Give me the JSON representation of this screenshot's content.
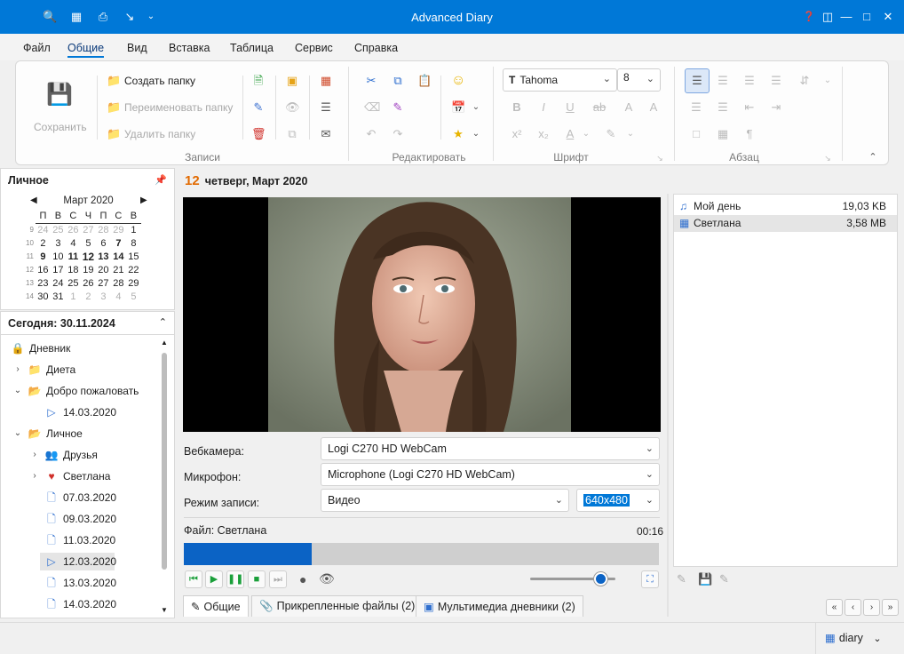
{
  "window": {
    "title": "Advanced Diary",
    "quick_access_icons": [
      "search-icon",
      "export-icon",
      "print-icon",
      "import-icon",
      "customize-chevron-icon"
    ],
    "controls": [
      "help-icon",
      "restore-layout-icon",
      "minimize-icon",
      "maximize-icon",
      "close-icon"
    ]
  },
  "menu": {
    "items": [
      "Файл",
      "Общие",
      "Вид",
      "Вставка",
      "Таблица",
      "Сервис",
      "Справка"
    ],
    "active": "Общие"
  },
  "ribbon": {
    "save_label": "Сохранить",
    "create_folder": "Создать папку",
    "rename_folder": "Переименовать папку",
    "delete_folder": "Удалить папку",
    "group_records": "Записи",
    "group_edit": "Редактировать",
    "group_font": "Шрифт",
    "group_paragraph": "Абзац",
    "font_name": "Tahoma",
    "font_size": "8",
    "font_icon": "T"
  },
  "left": {
    "personal_title": "Личное",
    "calendar": {
      "month": "Март 2020",
      "weekdays": [
        "П",
        "В",
        "С",
        "Ч",
        "П",
        "С",
        "В"
      ],
      "weeks": [
        {
          "wk": "9",
          "days": [
            "24",
            "25",
            "26",
            "27",
            "28",
            "29",
            "1"
          ]
        },
        {
          "wk": "10",
          "days": [
            "2",
            "3",
            "4",
            "5",
            "6",
            "7",
            "8"
          ]
        },
        {
          "wk": "11",
          "days": [
            "9",
            "10",
            "11",
            "12",
            "13",
            "14",
            "15"
          ]
        },
        {
          "wk": "12",
          "days": [
            "16",
            "17",
            "18",
            "19",
            "20",
            "21",
            "22"
          ]
        },
        {
          "wk": "13",
          "days": [
            "23",
            "24",
            "25",
            "26",
            "27",
            "28",
            "29"
          ]
        },
        {
          "wk": "14",
          "days": [
            "30",
            "31",
            "1",
            "2",
            "3",
            "4",
            "5"
          ]
        }
      ]
    },
    "today_label": "Сегодня: 30.11.2024",
    "tree": [
      {
        "label": "Дневник",
        "level": 0,
        "icon": "diary-icon",
        "twisty": ""
      },
      {
        "label": "Диета",
        "level": 1,
        "icon": "folder-icon",
        "twisty": "›"
      },
      {
        "label": "Добро пожаловать",
        "level": 1,
        "icon": "folder-open-icon",
        "twisty": "⌄"
      },
      {
        "label": "14.03.2020",
        "level": 2,
        "icon": "video-note-icon",
        "twisty": ""
      },
      {
        "label": "Личное",
        "level": 1,
        "icon": "folder-open-icon",
        "twisty": "⌄"
      },
      {
        "label": "Друзья",
        "level": 2,
        "icon": "folder-people-icon",
        "twisty": "›"
      },
      {
        "label": "Светлана",
        "level": 2,
        "icon": "folder-heart-icon",
        "twisty": "›"
      },
      {
        "label": "07.03.2020",
        "level": 2,
        "icon": "note-icon",
        "twisty": ""
      },
      {
        "label": "09.03.2020",
        "level": 2,
        "icon": "note-icon",
        "twisty": ""
      },
      {
        "label": "11.03.2020",
        "level": 2,
        "icon": "note-icon",
        "twisty": ""
      },
      {
        "label": "12.03.2020",
        "level": 2,
        "icon": "video-note-icon",
        "twisty": "",
        "selected": true
      },
      {
        "label": "13.03.2020",
        "level": 2,
        "icon": "note-icon",
        "twisty": ""
      },
      {
        "label": "14.03.2020",
        "level": 2,
        "icon": "note-icon",
        "twisty": ""
      }
    ]
  },
  "center": {
    "day_number": "12",
    "date_text": "четверг, Март 2020",
    "webcam_label": "Вебкамера:",
    "webcam_value": "Logi C270 HD WebCam",
    "mic_label": "Микрофон:",
    "mic_value": "Microphone (Logi C270 HD WebCam)",
    "mode_label": "Режим записи:",
    "mode_value": "Видео",
    "resolution_value": "640x480",
    "file_label": "Файл: Светлана",
    "duration": "00:16",
    "progress_fraction": 0.27,
    "volume_fraction": 0.82,
    "tabs": [
      {
        "label": "Общие",
        "icon": "pencil-icon"
      },
      {
        "label": "Прикрепленные файлы (2)",
        "icon": "paperclip-icon"
      },
      {
        "label": "Мультимедиа дневники (2)",
        "icon": "multimedia-icon"
      }
    ]
  },
  "right": {
    "files": [
      {
        "name": "Мой день",
        "size": "19,03 KB",
        "icon": "audio-file-icon"
      },
      {
        "name": "Светлана",
        "size": "3,58 MB",
        "icon": "video-file-icon",
        "selected": true
      }
    ]
  },
  "status": {
    "diary_label": "diary"
  },
  "colors": {
    "titlebar": "#0078d7",
    "accent": "#0078d7",
    "date_accent": "#e26a00",
    "progress_fill": "#0b63c5"
  }
}
